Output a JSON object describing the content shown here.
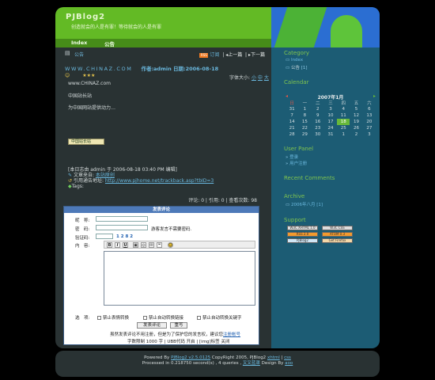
{
  "site": {
    "title": "PJBlog2",
    "subtitle": "创造就会的人是有罪！等待就会的人是有罪",
    "nav": [
      "Index",
      "公告"
    ]
  },
  "post": {
    "category": "公告",
    "rss_label": "RSS",
    "subscribe": "订阅",
    "prev": "上一篇",
    "next": "下一篇",
    "title": "WWW.CHINAZ.COM",
    "author_date": "作者:admin 日期:2006-08-18",
    "font_size_label": "字体大小:",
    "font_sizes": [
      "小",
      "中",
      "大"
    ],
    "stars": "★★★",
    "lines": [
      "www.CHINAZ.com",
      "中国站长站",
      "为中国网站提供动力…"
    ],
    "badge": "中国站长站",
    "meta1": "[本日志由 admin 于 2006-08-18 03:40 PM 编辑]",
    "meta2_label": "文章来自:",
    "meta2_link": "本站原创",
    "meta3_label": "引用通告地址:",
    "meta3_link": "http://www.pjhome.net/trackback.asp?tbID=3",
    "meta4_label": "Tags:",
    "stats": "评论: 0 | 引用: 0 | 查看次数: 98"
  },
  "form": {
    "heading": "发表评论",
    "name_label": "昵　称:",
    "pass_label": "密　码:",
    "pass_hint": "游客发言不需要密码.",
    "verify_label": "验证码:",
    "verify_code": "1 2 8 2",
    "content_label": "内　容:",
    "options_label": "选　项:",
    "options": [
      "禁止表情转换",
      "禁止自动转换链接",
      "禁止自动转换关键字"
    ],
    "submit": "发表评论",
    "reset": "重写",
    "notice": "虽然发表评论不用注册，但是为了保护您的发言权，建议您",
    "notice_link": "注册帐号",
    "limits": "字数限制 1000 字 | UBB代码 开启 | [img]标签 关闭"
  },
  "sidebar": {
    "category_title": "Category",
    "categories": [
      {
        "name": "Index",
        "count": ""
      },
      {
        "name": "公告",
        "count": "[1]"
      }
    ],
    "calendar_title": "Calendar",
    "calendar_header": "2007年1月",
    "weekdays": [
      "日",
      "一",
      "二",
      "三",
      "四",
      "五",
      "六"
    ],
    "weeks": [
      [
        "31",
        "1",
        "2",
        "3",
        "4",
        "5",
        "6"
      ],
      [
        "7",
        "8",
        "9",
        "10",
        "11",
        "12",
        "13"
      ],
      [
        "14",
        "15",
        "16",
        "17",
        "18",
        "19",
        "20"
      ],
      [
        "21",
        "22",
        "23",
        "24",
        "25",
        "26",
        "27"
      ],
      [
        "28",
        "29",
        "30",
        "31",
        "1",
        "2",
        "3"
      ]
    ],
    "today": "18",
    "userpanel_title": "User Panel",
    "userpanel_items": [
      "登录",
      "用户注册"
    ],
    "recent_title": "Recent Comments",
    "archive_title": "Archive",
    "archive_items": [
      "2006年八月 [1]"
    ],
    "support_title": "Support",
    "support_badges": [
      "W3C XHTML 1.0",
      "W3C CSS",
      "RSS 2.0",
      "ATOM 0.3",
      "PJBlog2",
      "Get Firefox"
    ]
  },
  "footer": {
    "line1_prefix": "Powered By",
    "line1_link": "PJBlog2 v2.5.0125",
    "line1_suffix": "CopyRight 2005, PJBlog2",
    "xhtml": "xhtml",
    "css": "css",
    "line2": "Processed in 0.218750 second(s) , 4 queries ,",
    "skin": "叉叉蓝罩",
    "design_by": "Design By",
    "designer": "aoo"
  },
  "colors": {
    "header_green": "#63ba25",
    "panel_dark": "#293233",
    "sidebar_teal": "#1c5c74",
    "link_blue": "#6ab8de",
    "today_green": "#67b83a"
  }
}
